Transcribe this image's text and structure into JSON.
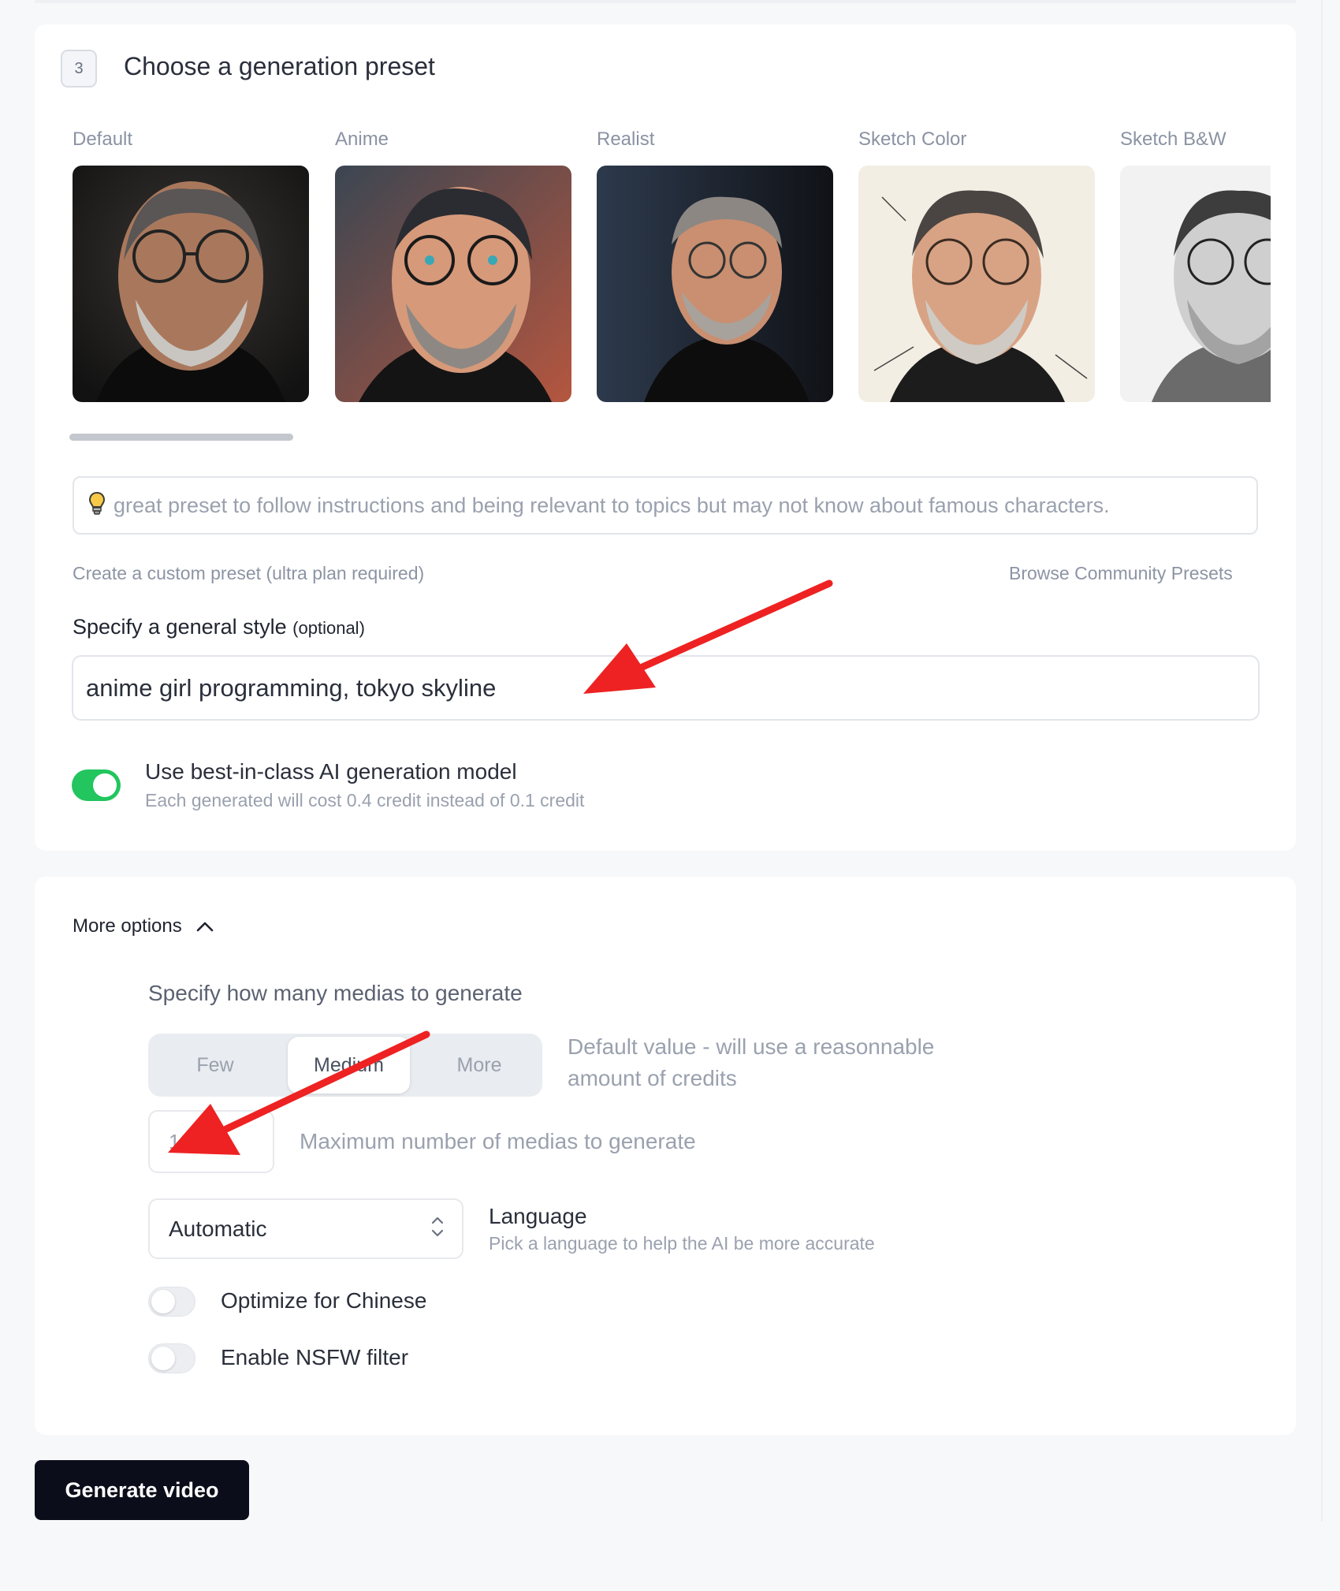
{
  "step": {
    "number": "3",
    "title": "Choose a generation preset"
  },
  "presets": [
    {
      "label": "Default"
    },
    {
      "label": "Anime"
    },
    {
      "label": "Realist"
    },
    {
      "label": "Sketch Color"
    },
    {
      "label": "Sketch B&W"
    }
  ],
  "hint": {
    "icon": "lightbulb-icon",
    "text": "great preset to follow instructions and being relevant to topics but may not know about famous characters."
  },
  "links": {
    "custom_preset": "Create a custom preset (ultra plan required)",
    "community": "Browse Community Presets"
  },
  "style": {
    "label": "Specify a general style",
    "optional": "(optional)",
    "value": "anime girl programming, tokyo skyline"
  },
  "model": {
    "enabled": true,
    "title": "Use best-in-class AI generation model",
    "subtitle": "Each generated will cost 0.4 credit instead of 0.1 credit"
  },
  "more_options": {
    "label": "More options",
    "icon": "chevron-up-icon"
  },
  "media_count": {
    "title": "Specify how many medias to generate",
    "options": [
      "Few",
      "Medium",
      "More"
    ],
    "selected": "Medium",
    "description": "Default value - will use a reasonnable amount of credits",
    "max_value": "10",
    "max_label": "Maximum number of medias to generate"
  },
  "language": {
    "value": "Automatic",
    "title": "Language",
    "subtitle": "Pick a language to help the AI be more accurate"
  },
  "switches": {
    "chinese": {
      "label": "Optimize for Chinese",
      "enabled": false
    },
    "nsfw": {
      "label": "Enable NSFW filter",
      "enabled": false
    }
  },
  "generate_button": "Generate video",
  "colors": {
    "accent_green": "#22c55e",
    "annotation_red": "#ee2222",
    "button_dark": "#0b0e1a"
  }
}
